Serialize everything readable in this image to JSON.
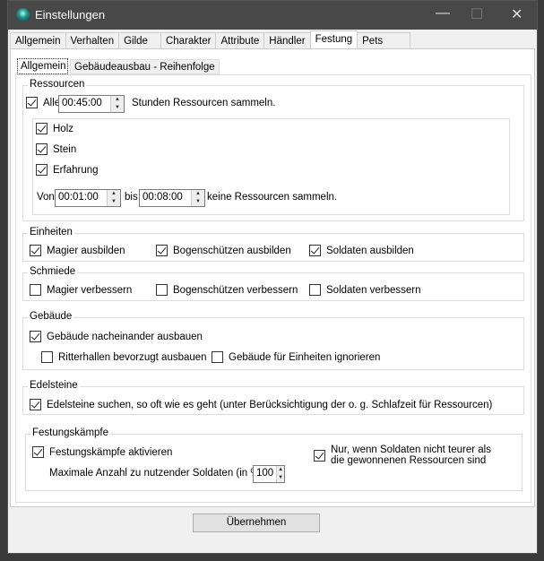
{
  "window": {
    "title": "Einstellungen",
    "minimize": "—",
    "maximize": "☐",
    "close": "✕"
  },
  "tabs": [
    "Allgemein",
    "Verhalten",
    "Gilde",
    "Charakter",
    "Attribute",
    "Händler",
    "Festung",
    "Pets"
  ],
  "selected_tab": "Festung",
  "subtabs": [
    "Allgemein",
    "Gebäudeausbau - Reihenfolge"
  ],
  "ressourcen": {
    "label": "Ressourcen",
    "alle_label": "Alle",
    "alle_checked": true,
    "interval": "00:45:00",
    "suffix": "Stunden Ressourcen sammeln.",
    "items": [
      {
        "label": "Holz",
        "checked": true
      },
      {
        "label": "Stein",
        "checked": true
      },
      {
        "label": "Erfahrung",
        "checked": true
      }
    ],
    "von_label": "Von",
    "von": "00:01:00",
    "bis_label": "bis",
    "bis": "00:08:00",
    "pause_suffix": "keine Ressourcen sammeln."
  },
  "einheiten": {
    "label": "Einheiten",
    "items": [
      {
        "label": "Magier ausbilden",
        "checked": true
      },
      {
        "label": "Bogenschützen ausbilden",
        "checked": true
      },
      {
        "label": "Soldaten ausbilden",
        "checked": true
      }
    ]
  },
  "schmiede": {
    "label": "Schmiede",
    "items": [
      {
        "label": "Magier verbessern",
        "checked": false
      },
      {
        "label": "Bogenschützen verbessern",
        "checked": false
      },
      {
        "label": "Soldaten verbessern",
        "checked": false
      }
    ]
  },
  "gebaeude": {
    "label": "Gebäude",
    "items": [
      {
        "label": "Gebäude nacheinander ausbauen",
        "checked": true
      },
      {
        "label": "Ritterhallen bevorzugt ausbauen",
        "checked": false
      },
      {
        "label": "Gebäude für Einheiten ignorieren",
        "checked": false
      }
    ]
  },
  "edelsteine": {
    "label": "Edelsteine",
    "item": {
      "label": "Edelsteine suchen, so oft wie es geht (unter Berücksichtigung der o. g. Schlafzeit für Ressourcen)",
      "checked": true
    }
  },
  "kaempfe": {
    "label": "Festungskämpfe",
    "activate": {
      "label": "Festungskämpfe aktivieren",
      "checked": true
    },
    "max_label": "Maximale Anzahl zu nutzender Soldaten (in %):",
    "max_value": "100",
    "only_if": {
      "label1": "Nur, wenn Soldaten nicht teurer als",
      "label2": "die gewonnenen Ressourcen sind",
      "checked": true
    }
  },
  "apply_button": "Übernehmen"
}
